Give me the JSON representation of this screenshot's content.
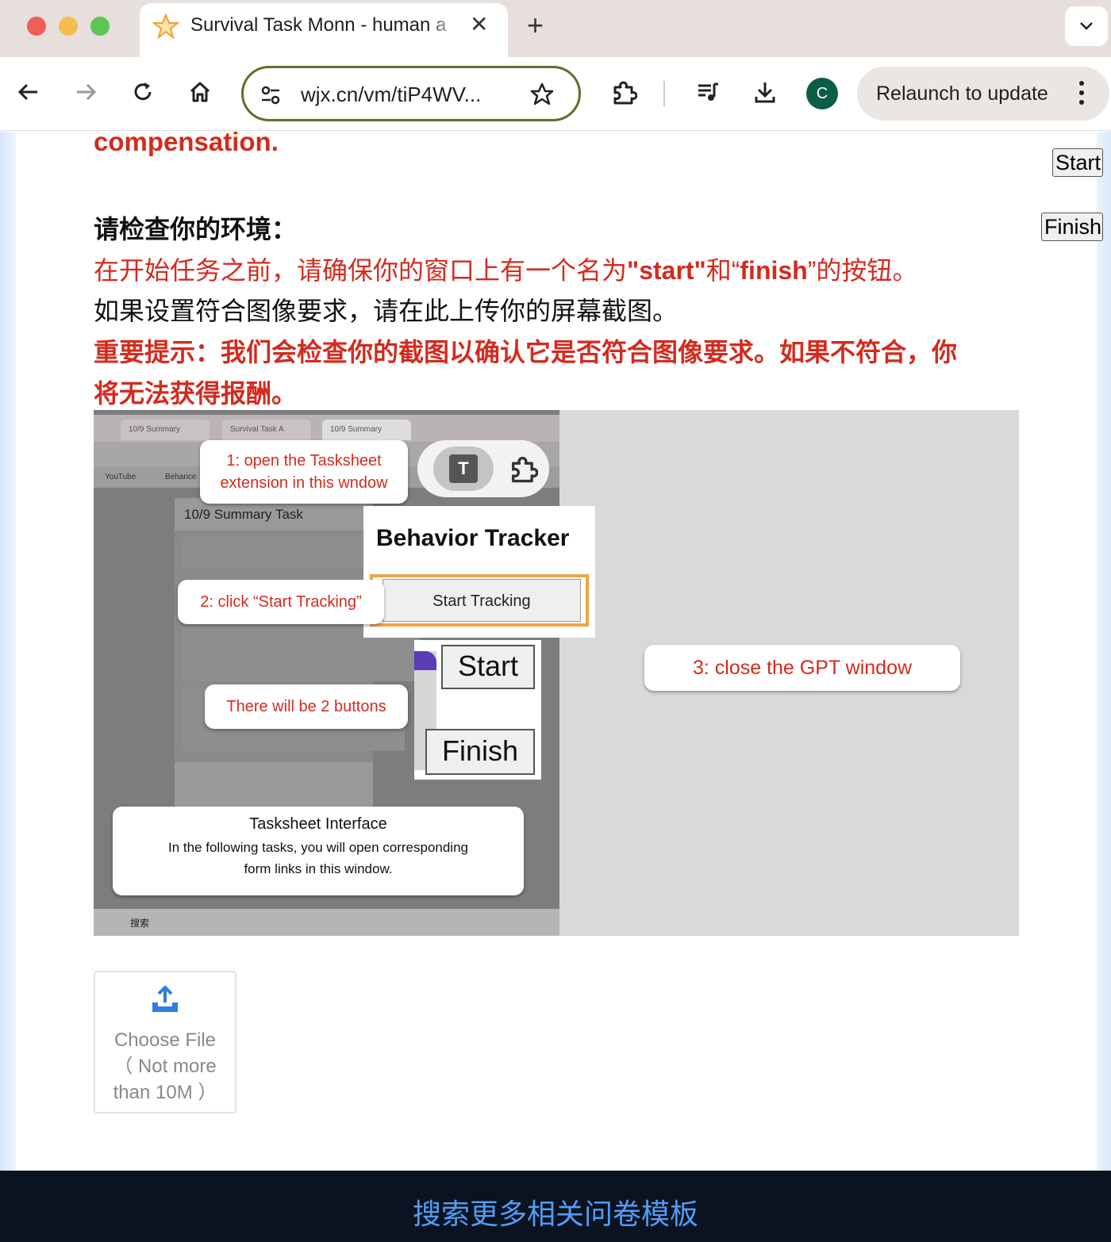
{
  "browser": {
    "tab_title": "Survival Task Monn - human a",
    "url": "wjx.cn/vm/tiP4WV...",
    "profile_initial": "C",
    "relaunch_label": "Relaunch to update"
  },
  "page": {
    "compensation_text": "compensation.",
    "check_heading": "请检查你的环境：",
    "line1_pre": "在开始任务之前，请确保你的窗口上有一个名为",
    "line1_start": "\"start\"",
    "line1_mid": "和“",
    "line1_finish": "finish",
    "line1_post": "”的按钮。",
    "line2": "如果设置符合图像要求，请在此上传你的屏幕截图。",
    "line3": "重要提示：我们会检查你的截图以确认它是否符合图像要求。如果不符合，你",
    "line4": "将无法获得报酬。",
    "float_start": "Start",
    "float_finish": "Finish",
    "upload": {
      "line1": "Choose File",
      "line2": "（ Not more",
      "line3": "than 10M ）"
    },
    "footer_link": "搜索更多相关问卷模板"
  },
  "instruction_image": {
    "tabs": [
      "10/9 Summary",
      "Survival Task A",
      "10/9 Summary"
    ],
    "bookmarks": [
      "YouTube",
      "Behance"
    ],
    "form_title": "10/9 Summary Task",
    "step1_line1": "1: open the Tasksheet",
    "step1_line2": "extension in this wndow",
    "ext_letter": "T",
    "tracker_title": "Behavior Tracker",
    "tracker_button": "Start Tracking",
    "step2": "2: click “Start Tracking”",
    "start": "Start",
    "finish": "Finish",
    "buttons_note": "There will be 2 buttons",
    "step3": "3: close the GPT window",
    "sheet_title": "Tasksheet Interface",
    "sheet_desc_line1": "In the following tasks, you will open corresponding",
    "sheet_desc_line2": "form links in this window.",
    "taskbar_search": "搜索"
  },
  "colors": {
    "accent_red": "#d32b1e",
    "footer_bg": "#0b1220",
    "footer_link": "#4f9ef6",
    "upload_icon": "#2f7de1",
    "profile": "#0d5c45"
  }
}
